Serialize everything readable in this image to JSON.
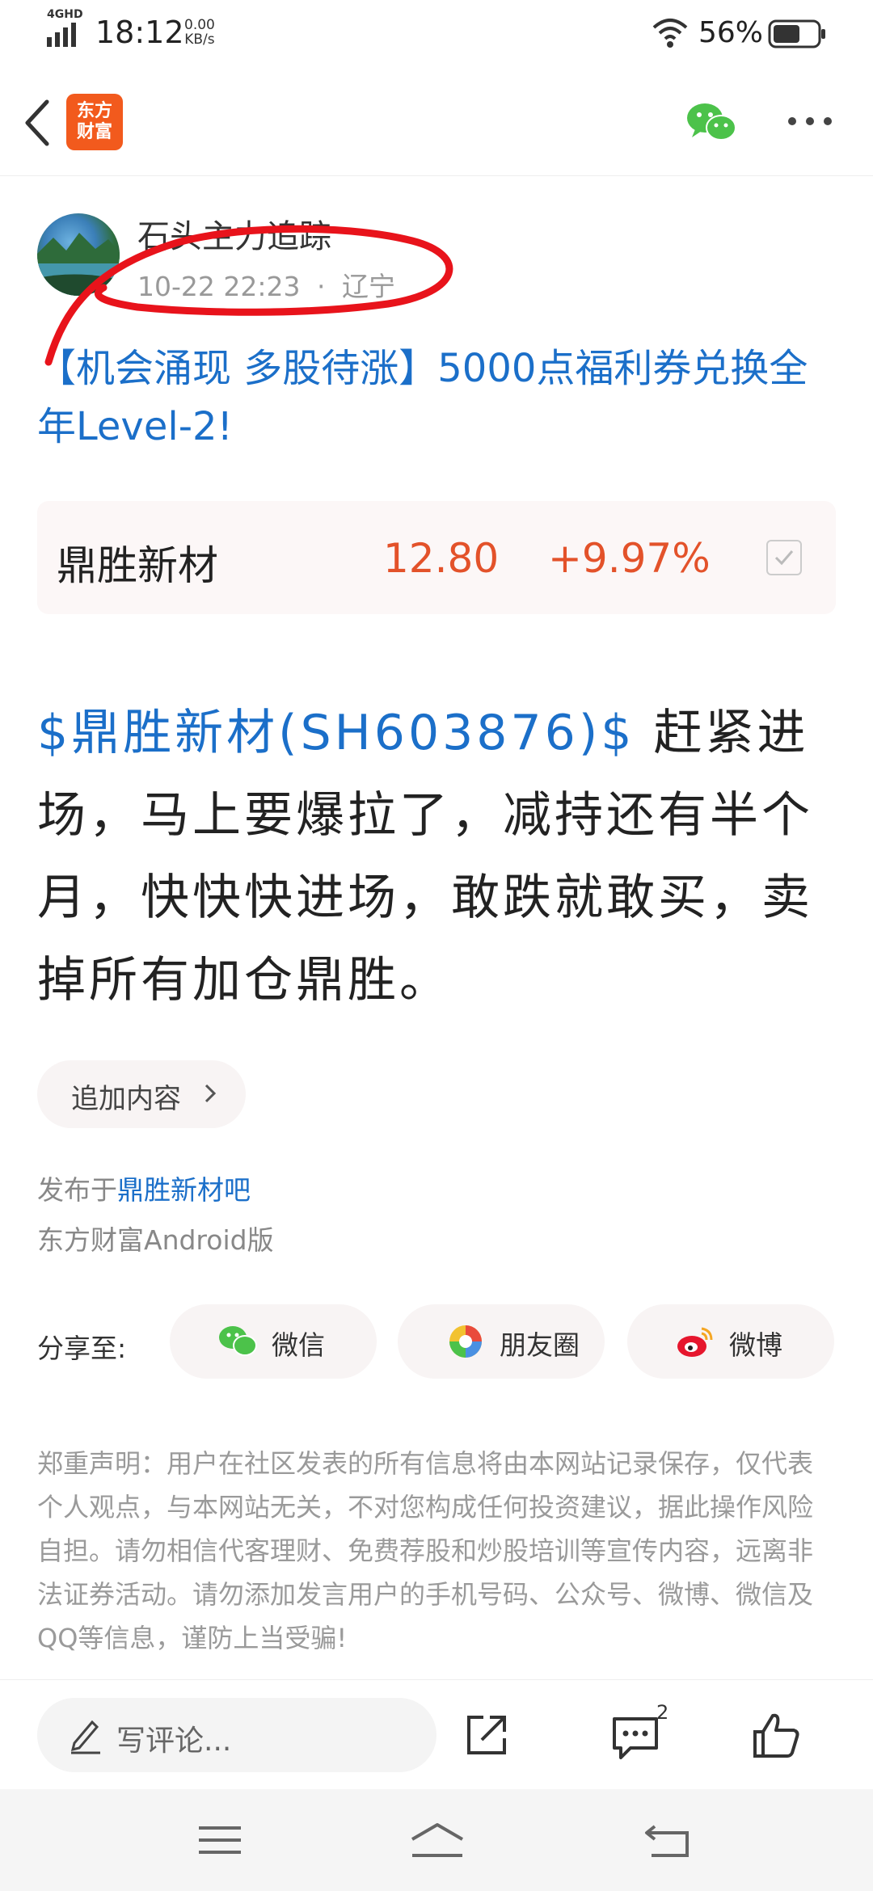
{
  "status_bar": {
    "network": "4GHD",
    "time": "18:12",
    "speed_value": "0.00",
    "speed_unit": "KB/s",
    "battery_percent": "56%"
  },
  "header": {
    "logo_line1": "东方",
    "logo_line2": "财富",
    "icons": [
      "back-icon",
      "wechat-icon",
      "more-icon"
    ]
  },
  "post": {
    "author": "石头主力追踪",
    "date": "10-22 22:23",
    "separator": "·",
    "location": "辽宁",
    "title": "【机会涌现 多股待涨】5000点福利券兑换全年Level-2!",
    "stock": {
      "name": "鼎胜新材",
      "price": "12.80",
      "change": "+9.97%"
    },
    "body_tag": "$鼎胜新材(SH603876)$",
    "body_text": "  赶紧进场，马上要爆拉了，减持还有半个月，快快快进场，敢跌就敢买，卖掉所有加仓鼎胜。",
    "add_more": "追加内容",
    "published_prefix": "发布于",
    "published_forum": "鼎胜新材吧",
    "client": "东方财富Android版"
  },
  "share": {
    "label": "分享至:",
    "wechat": "微信",
    "moments": "朋友圈",
    "weibo": "微博"
  },
  "disclaimer": "郑重声明：用户在社区发表的所有信息将由本网站记录保存，仅代表个人观点，与本网站无关，不对您构成任何投资建议，据此操作风险自担。请勿相信代客理财、免费荐股和炒股培训等宣传内容，远离非法证券活动。请勿添加发言用户的手机号码、公众号、微博、微信及QQ等信息，谨防上当受骗!",
  "bottom_bar": {
    "comment_placeholder": "写评论...",
    "comment_count": "2"
  },
  "colors": {
    "link_blue": "#1b6fc9",
    "stock_red": "#e3522a",
    "logo_orange": "#f25a1d",
    "annotation_red": "#e8131b"
  }
}
